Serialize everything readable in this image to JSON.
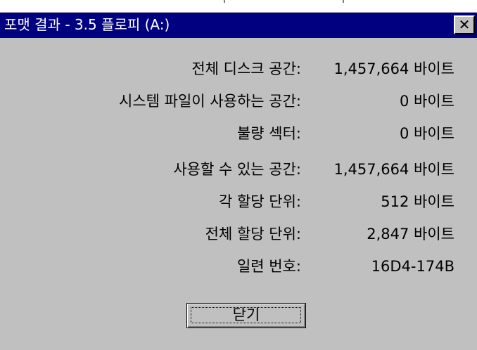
{
  "window": {
    "title": "포맷 결과 - 3.5 플로피 (A:)",
    "close_glyph": "✕"
  },
  "results": [
    {
      "label": "전체 디스크 공간:",
      "value": "1,457,664 바이트"
    },
    {
      "label": "시스템 파일이 사용하는 공간:",
      "value": "0 바이트"
    },
    {
      "label": "불량 섹터:",
      "value": "0 바이트"
    },
    {
      "label": "사용할 수 있는 공간:",
      "value": "1,457,664 바이트"
    },
    {
      "label": "각 할당 단위:",
      "value": "512 바이트"
    },
    {
      "label": "전체 할당 단위:",
      "value": "2,847 바이트"
    },
    {
      "label": "일련 번호:",
      "value": "16D4-174B"
    }
  ],
  "buttons": {
    "close_label": "닫기"
  },
  "colors": {
    "title_bar": "#000080",
    "face": "#c0c0c0"
  }
}
